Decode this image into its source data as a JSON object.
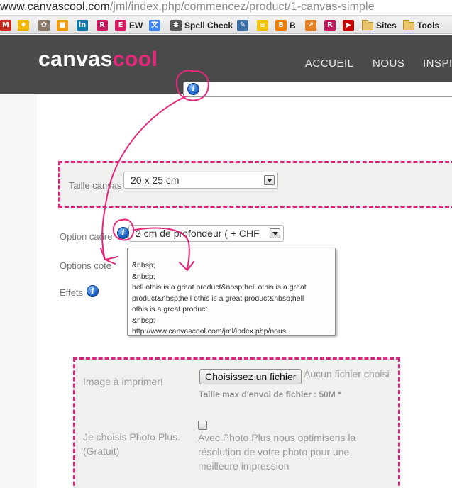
{
  "browser": {
    "url_host": "www.canvascool.com",
    "url_path": "/jml/index.php/commencez/product/1-canvas-simple",
    "bookmarks": [
      {
        "label": "",
        "icon": "gmail-icon",
        "color": "#c5281c",
        "glyph": "M"
      },
      {
        "label": "",
        "icon": "lightbulb-icon",
        "color": "#f2b705",
        "glyph": "♦"
      },
      {
        "label": "",
        "icon": "pet-icon",
        "color": "#8a7b6a",
        "glyph": "✿"
      },
      {
        "label": "",
        "icon": "orange-square-icon",
        "color": "#f39c12",
        "glyph": "■"
      },
      {
        "label": "",
        "icon": "linkedin-icon",
        "color": "#0e76a8",
        "glyph": "in"
      },
      {
        "label": "",
        "icon": "r-icon",
        "color": "#c2185b",
        "glyph": "R"
      },
      {
        "label": "EW",
        "icon": "e-icon",
        "color": "#d81b60",
        "glyph": "E"
      },
      {
        "label": "",
        "icon": "translate-icon",
        "color": "#4285f4",
        "glyph": "文"
      },
      {
        "label": "Spell Check",
        "icon": "spellcheck-icon",
        "color": "#555555",
        "glyph": "✱"
      },
      {
        "label": "",
        "icon": "edit-icon",
        "color": "#3b6ea5",
        "glyph": "✎"
      },
      {
        "label": "",
        "icon": "rss-icon",
        "color": "#f2c40f",
        "glyph": "≋"
      },
      {
        "label": "B",
        "icon": "blogger-icon",
        "color": "#f57d00",
        "glyph": "B"
      },
      {
        "label": "",
        "icon": "chart-icon",
        "color": "#e67e22",
        "glyph": "↗"
      },
      {
        "label": "",
        "icon": "r2-icon",
        "color": "#c2185b",
        "glyph": "R"
      },
      {
        "label": "",
        "icon": "youtube-icon",
        "color": "#cc0000",
        "glyph": "▶"
      },
      {
        "label": "Sites",
        "icon": "folder-icon",
        "color": "",
        "glyph": ""
      },
      {
        "label": "Tools",
        "icon": "folder-icon",
        "color": "",
        "glyph": ""
      }
    ]
  },
  "header": {
    "logo_part1": "canvas",
    "logo_part2": "cool",
    "logo_accent": "#e6287d",
    "nav": [
      "ACCUEIL",
      "NOUS",
      "INSPI"
    ]
  },
  "form": {
    "size_label": "Taille canvas",
    "size_value": "20 x 25 cm",
    "frame_label": "Option cadre",
    "frame_value": "2 cm de profondeur ( + CHF",
    "sides_label": "Options cote",
    "effects_label": "Effets",
    "tooltip_lines": [
      "&nbsp;",
      "&nbsp;",
      "hell othis is a great product&nbsp;hell othis is a great",
      "product&nbsp;hell othis is a great product&nbsp;hell",
      "othis is a great product",
      "&nbsp;",
      "http://www.canvascool.com/jml/index.php/nous"
    ],
    "image_label": "Image à imprimer!",
    "file_button": "Choisissez un fichier",
    "file_status": "Aucun fichier choisi",
    "file_max": "Taille max d'envoi de fichier : 50M *",
    "photo_plus_label_1": "Je choisis Photo Plus.",
    "photo_plus_label_2": "(Gratuit)",
    "photo_plus_desc": [
      "Avec Photo Plus nous optimisons la",
      "résolution de votre photo pour une",
      "meilleure impression"
    ]
  },
  "colors": {
    "annotation": "#e6287d",
    "panel_border": "#d6277b",
    "header_bg": "#4a4a4a"
  }
}
